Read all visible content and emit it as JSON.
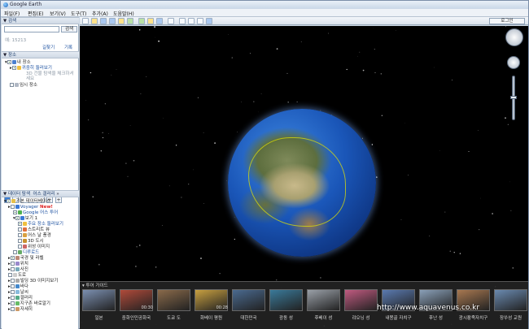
{
  "window": {
    "title": "Google Earth"
  },
  "menu": [
    "파일(F)",
    "편집(E)",
    "보기(V)",
    "도구(T)",
    "추가(A)",
    "도움말(H)"
  ],
  "toolbar": {
    "login_label": "로그인"
  },
  "search": {
    "header": "검색",
    "button": "검색",
    "example": "예: 15213",
    "links": [
      "길찾기",
      "기록"
    ]
  },
  "places": {
    "header": "장소",
    "items": [
      "내 장소",
      "귀중히 둘러보기",
      "3D 건물 탐색을 체크하셔",
      "세요",
      "임시 장소"
    ]
  },
  "layers": {
    "header_left": "데이터 탐색",
    "header_right": "어스 갤러리",
    "items": [
      "기본 데이터베이스",
      "Voyager",
      "New!",
      "Google 어스 투어",
      "보기 1",
      "주요 장소 둘러보기",
      "스트리트 뷰",
      "어스 날 풍경",
      "3D 도시",
      "위성 이미지",
      "디루로드",
      "국경 및 라벨",
      "위치",
      "사진",
      "도로",
      "빌딩 3D 이미지보기",
      "바다",
      "날씨",
      "갤러리",
      "지구촌 바로알기",
      "자세히"
    ]
  },
  "tour": {
    "title": "투어 가이드",
    "labels": [
      "일본",
      "중화인민공화국",
      "도쿄 도",
      "화베이 평원",
      "대한민국",
      "광동 성",
      "후베이 성",
      "랴오닝 성",
      "내몽골 자치구",
      "후난 성",
      "광시좡족자치구",
      "장쑤성 교원"
    ],
    "badges": [
      "00:30",
      "00:28"
    ]
  },
  "watermark": "http://www.aquavenus.co.kr"
}
